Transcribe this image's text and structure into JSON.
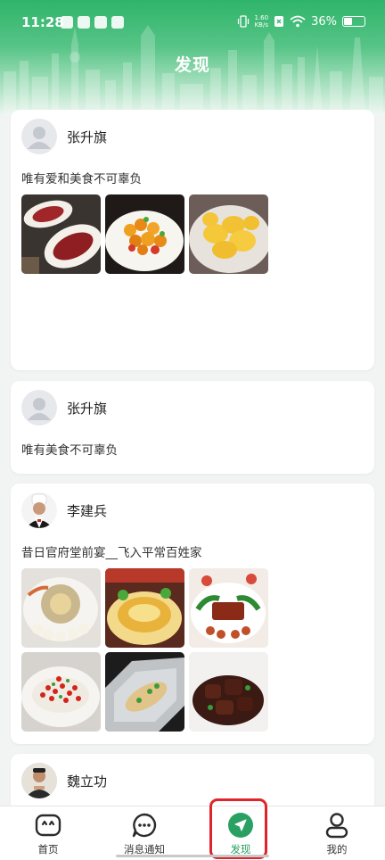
{
  "status_bar": {
    "time": "11:28",
    "network_speed_value": "1.60",
    "network_speed_unit": "KB/s",
    "battery": "36%"
  },
  "header": {
    "title": "发现"
  },
  "posts": [
    {
      "author": "张升旗",
      "text": "唯有爱和美食不可辜负",
      "avatar_icon": "default-avatar-icon",
      "images": [
        "roast-meat-platter",
        "sweet-and-sour-pork",
        "braised-potatoes"
      ]
    },
    {
      "author": "张升旗",
      "text": "唯有美食不可辜负",
      "avatar_icon": "default-avatar-icon",
      "images": []
    },
    {
      "author": "李建兵",
      "text": "昔日官府堂前宴__飞入平常百姓家",
      "avatar_icon": "chef-photo",
      "images": [
        "abalone-platter",
        "soup-bowl-dish",
        "braised-pork-dish",
        "chili-fish",
        "foil-baked-fish",
        "braised-beef"
      ]
    },
    {
      "author": "魏立功",
      "avatar_icon": "user-photo"
    }
  ],
  "bottom_nav": [
    {
      "label": "首页",
      "icon": "home-face-icon",
      "active": false
    },
    {
      "label": "消息通知",
      "icon": "chat-bubble-icon",
      "active": false
    },
    {
      "label": "发现",
      "icon": "send-arrow-icon",
      "active": true
    },
    {
      "label": "我的",
      "icon": "person-icon",
      "active": false
    }
  ],
  "colors": {
    "accent": "#2aa062",
    "header_top": "#2fb46a",
    "highlight": "#e0242b"
  }
}
